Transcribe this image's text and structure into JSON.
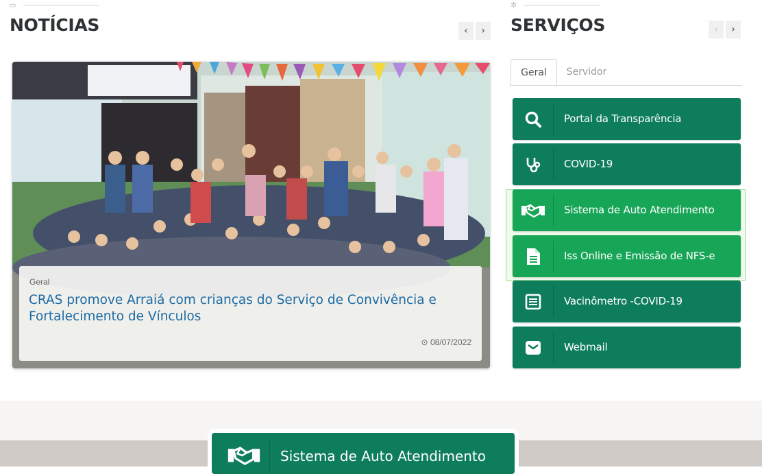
{
  "news": {
    "title": "NOTÍCIAS",
    "prev_icon": "chevron-left",
    "next_icon": "chevron-right",
    "article": {
      "category": "Geral",
      "title": "CRAS promove Arraiá com crianças do Serviço de Convivência e Fortalecimento de Vínculos",
      "date": "08/07/2022",
      "date_icon": "clock-icon"
    }
  },
  "services": {
    "title": "SERVIÇOS",
    "tabs": [
      {
        "label": "Geral",
        "active": true
      },
      {
        "label": "Servidor",
        "active": false
      }
    ],
    "items": [
      {
        "label": "Portal da Transparência",
        "icon": "search-icon"
      },
      {
        "label": "COVID-19",
        "icon": "stethoscope-icon"
      },
      {
        "label": "Sistema de Auto Atendimento",
        "icon": "handshake-icon"
      },
      {
        "label": "Iss Online e Emissão de NFS-e",
        "icon": "document-icon"
      },
      {
        "label": "Vacinômetro -COVID-19",
        "icon": "clipboard-icon"
      },
      {
        "label": "Webmail",
        "icon": "envelope-icon"
      }
    ]
  },
  "banner": {
    "label": "Sistema de Auto Atendimento",
    "icon": "handshake-icon"
  },
  "colors": {
    "service_green": "#0e7d5c",
    "hover_green": "#17a557",
    "link_blue": "#1c6aa3"
  }
}
